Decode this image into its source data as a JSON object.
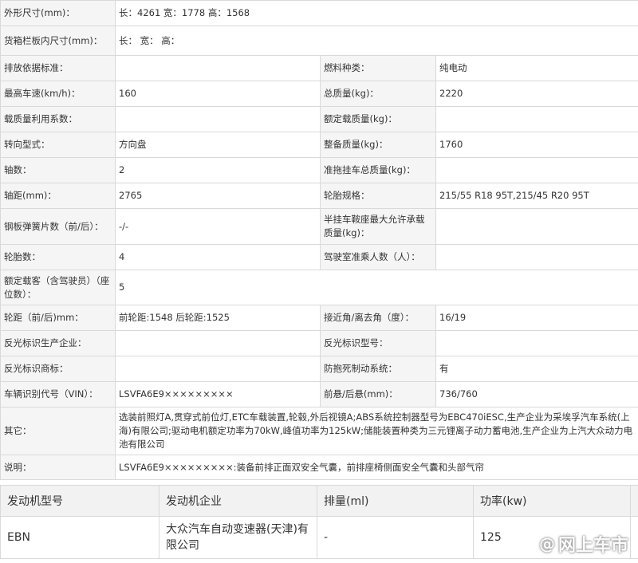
{
  "spec": {
    "r1": {
      "l1": "外形尺寸(mm)：",
      "v1": "长：4261 宽：1778 高：1568"
    },
    "r2": {
      "l1": "货箱栏板内尺寸(mm)：",
      "v1": "长： 宽： 高："
    },
    "r3": {
      "l1": "排放依据标准：",
      "v1": "",
      "l2": "燃料种类：",
      "v2": "纯电动"
    },
    "r4": {
      "l1": "最高车速(km/h)：",
      "v1": "160",
      "l2": "总质量(kg)：",
      "v2": "2220"
    },
    "r5": {
      "l1": "载质量利用系数：",
      "v1": "",
      "l2": "额定载质量(kg)：",
      "v2": ""
    },
    "r6": {
      "l1": "转向型式：",
      "v1": "方向盘",
      "l2": "整备质量(kg)：",
      "v2": "1760"
    },
    "r7": {
      "l1": "轴数：",
      "v1": "2",
      "l2": "准拖挂车总质量(kg)：",
      "v2": ""
    },
    "r8": {
      "l1": "轴距(mm)：",
      "v1": "2765",
      "l2": "轮胎规格：",
      "v2": "215/55 R18 95T,215/45 R20 95T"
    },
    "r9": {
      "l1": "钢板弹簧片数（前/后）：",
      "v1": "-/-",
      "l2": "半挂车鞍座最大允许承载质量(kg)：",
      "v2": ""
    },
    "r10": {
      "l1": "轮胎数：",
      "v1": "4",
      "l2": "驾驶室准乘人数（人）：",
      "v2": ""
    },
    "r11": {
      "l1": "额定载客（含驾驶员）（座位数）：",
      "v1": "5"
    },
    "r12": {
      "l1": "轮距（前/后)mm：",
      "v1": "前轮距:1548 后轮距:1525",
      "l2": "接近角/离去角（度）：",
      "v2": "16/19"
    },
    "r13": {
      "l1": "反光标识生产企业：",
      "v1": "",
      "l2": "反光标识型号：",
      "v2": ""
    },
    "r14": {
      "l1": "反光标识商标：",
      "v1": "",
      "l2": "防抱死制动系统：",
      "v2": "有"
    },
    "r15": {
      "l1": "车辆识别代号（VIN）：",
      "v1": "LSVFA6E9×××××××××",
      "l2": "前悬/后悬(mm)：",
      "v2": "736/760"
    },
    "r16": {
      "l1": "其它：",
      "v1": "选装前照灯A,贯穿式前位灯,ETC车载装置,轮毂,外后视镜A;ABS系统控制器型号为EBC470iESC,生产企业为采埃孚汽车系统(上海)有限公司;驱动电机额定功率为70kW,峰值功率为125kW;储能装置种类为三元锂离子动力蓄电池,生产企业为上汽大众动力电池有限公司"
    },
    "r17": {
      "l1": "说明：",
      "v1": "LSVFA6E9×××××××××:装备前排正面双安全气囊，前排座椅侧面安全气囊和头部气帘"
    }
  },
  "engine": {
    "headers": [
      "发动机型号",
      "发动机企业",
      "排量(ml)",
      "功率(kw)"
    ],
    "row": [
      "EBN",
      "大众汽车自动变速器(天津)有限公司",
      "-",
      "125"
    ]
  },
  "watermark": {
    "at": "@",
    "text": "网上车市"
  }
}
